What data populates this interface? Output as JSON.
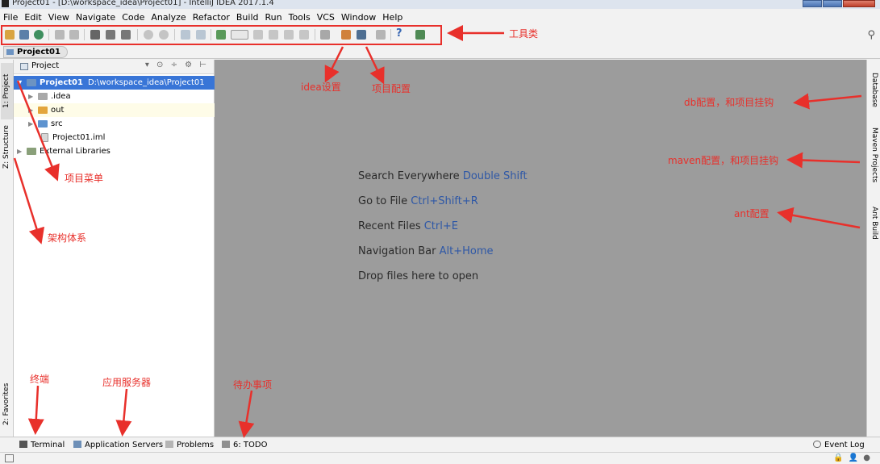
{
  "window": {
    "title": "Project01 - [D:\\workspace_idea\\Project01] - IntelliJ IDEA 2017.1.4"
  },
  "menu": [
    "File",
    "Edit",
    "View",
    "Navigate",
    "Code",
    "Analyze",
    "Refactor",
    "Build",
    "Run",
    "Tools",
    "VCS",
    "Window",
    "Help"
  ],
  "breadcrumb": {
    "label": "Project01"
  },
  "left_tabs": {
    "project": "1: Project",
    "structure": "Z: Structure",
    "favorites": "2: Favorites"
  },
  "project_panel": {
    "header": "Project",
    "tree": [
      {
        "name": "Project01",
        "path": "D:\\workspace_idea\\Project01",
        "type": "module",
        "expanded": true
      },
      {
        "name": ".idea",
        "type": "folder"
      },
      {
        "name": "out",
        "type": "folder-orange"
      },
      {
        "name": "src",
        "type": "folder-blue"
      },
      {
        "name": "Project01.iml",
        "type": "file"
      },
      {
        "name": "External Libraries",
        "type": "library"
      }
    ]
  },
  "editor_hints": [
    {
      "text": "Search Everywhere",
      "key": "Double Shift"
    },
    {
      "text": "Go to File",
      "key": "Ctrl+Shift+R"
    },
    {
      "text": "Recent Files",
      "key": "Ctrl+E"
    },
    {
      "text": "Navigation Bar",
      "key": "Alt+Home"
    },
    {
      "text": "Drop files here to open",
      "key": ""
    }
  ],
  "right_tabs": {
    "database": "Database",
    "maven": "Maven Projects",
    "ant": "Ant Build"
  },
  "bottom_tabs": {
    "terminal": "Terminal",
    "app_servers": "Application Servers",
    "problems": "Problems",
    "todo": "6: TODO",
    "event_log": "Event Log"
  },
  "annotations": {
    "toolbar": "工具类",
    "idea_settings": "idea设置",
    "project_config": "项目配置",
    "db": "db配置，和项目挂钩",
    "maven": "maven配置，和项目挂钩",
    "ant": "ant配置",
    "project_menu": "项目菜单",
    "structure": "架构体系",
    "terminal": "终端",
    "app_server": "应用服务器",
    "todo": "待办事项"
  },
  "colors": {
    "annotation": "#e8302b",
    "selection": "#3875d7",
    "editor_bg": "#9c9c9c",
    "hint_key": "#2f58a6"
  }
}
